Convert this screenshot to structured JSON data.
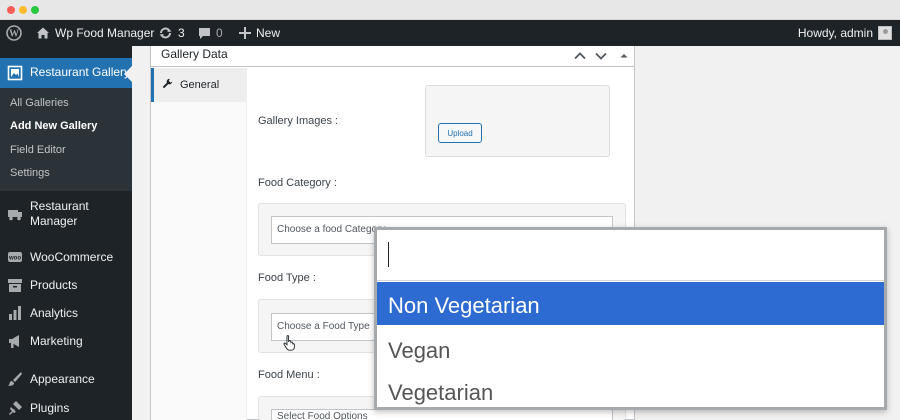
{
  "adminbar": {
    "site_name": "Wp Food Manager",
    "updates_count": "3",
    "comments_count": "0",
    "new_label": "New",
    "greeting": "Howdy, admin"
  },
  "sidebar": {
    "active_item": "Restaurant Gallery",
    "submenu": [
      "All Galleries",
      "Add New Gallery",
      "Field Editor",
      "Settings"
    ],
    "items": [
      {
        "label": "Restaurant Manager",
        "icon": "truck-icon"
      },
      {
        "label": "WooCommerce",
        "icon": "woo-icon"
      },
      {
        "label": "Products",
        "icon": "archive-icon"
      },
      {
        "label": "Analytics",
        "icon": "bar-chart-icon"
      },
      {
        "label": "Marketing",
        "icon": "megaphone-icon"
      },
      {
        "label": "Appearance",
        "icon": "paintbrush-icon"
      },
      {
        "label": "Plugins",
        "icon": "plug-icon"
      }
    ]
  },
  "metabox": {
    "title": "Gallery Data",
    "tab_general": "General",
    "fields": {
      "gallery_images_label": "Gallery Images :",
      "upload_label": "Upload",
      "food_category_label": "Food Category :",
      "food_category_placeholder": "Choose a food Category",
      "food_type_label": "Food Type :",
      "food_type_placeholder": "Choose a Food Type",
      "food_menu_label": "Food Menu :",
      "food_menu_placeholder": "Select Food Options"
    }
  },
  "dropdown": {
    "search_value": "",
    "options": [
      "Non Vegetarian",
      "Vegan",
      "Vegetarian"
    ],
    "highlighted": "Non Vegetarian"
  },
  "colors": {
    "admin_dark": "#1d2327",
    "accent_blue": "#2271b1",
    "highlight_blue": "#2d6ad1"
  }
}
